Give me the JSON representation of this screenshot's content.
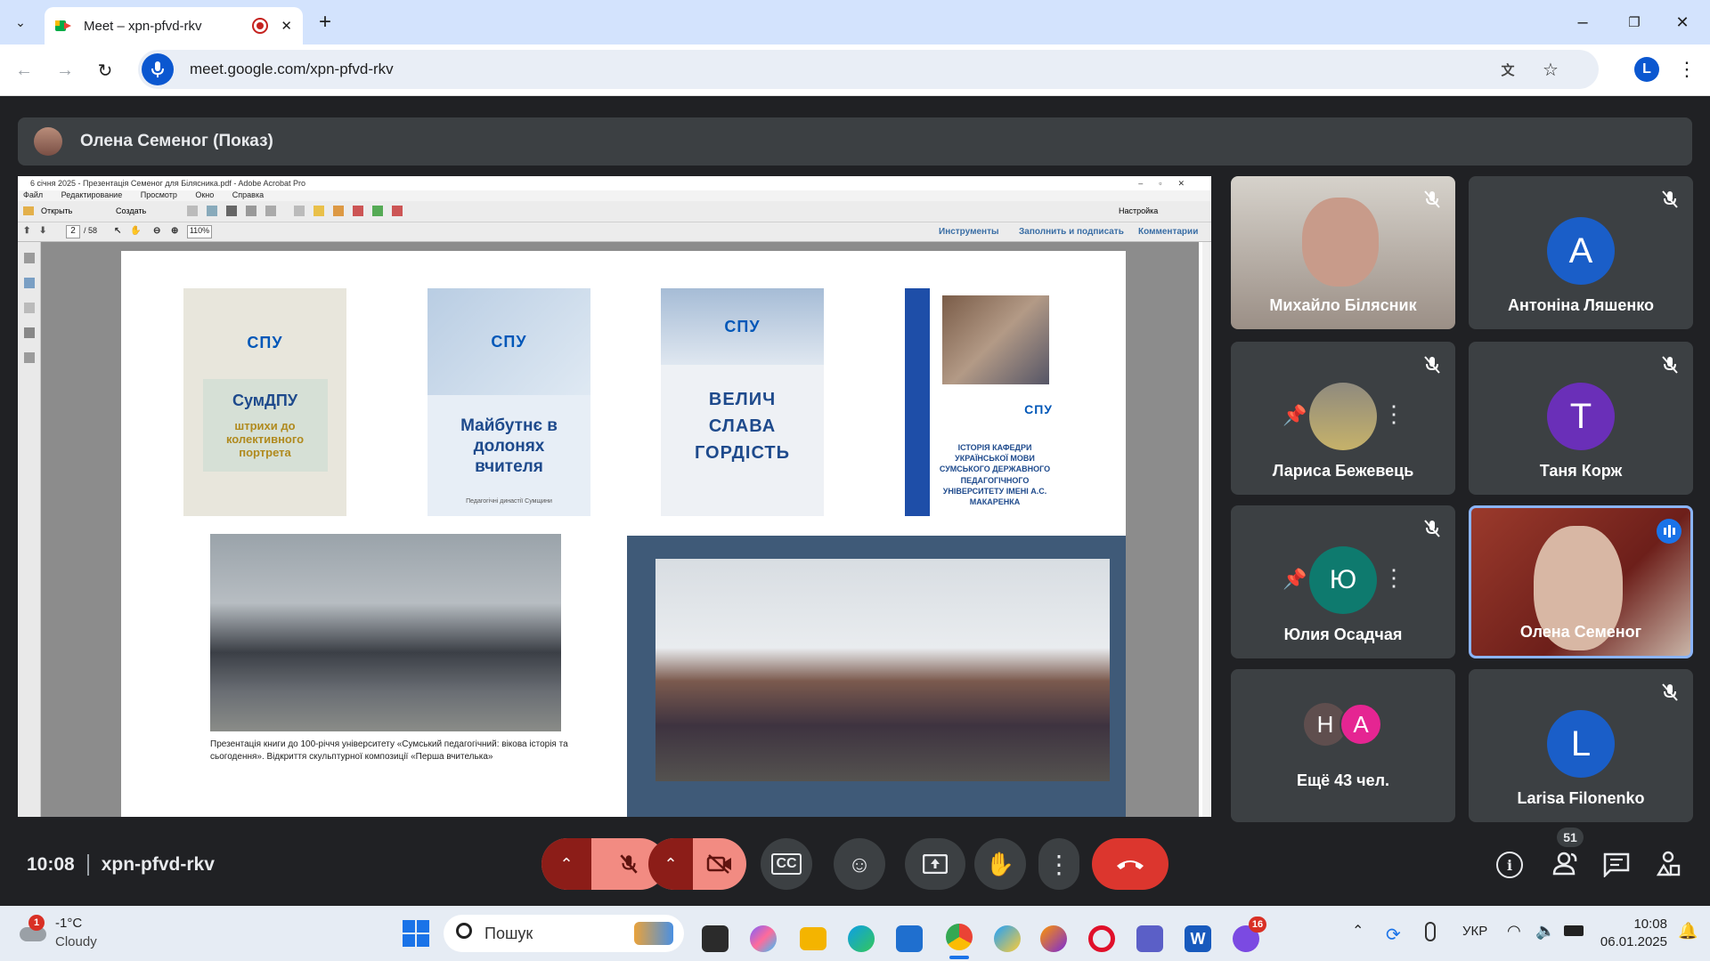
{
  "browser": {
    "tab_title": "Meet – xpn-pfvd-rkv",
    "url": "meet.google.com/xpn-pfvd-rkv",
    "profile_initial": "L"
  },
  "meet": {
    "presenter_label": "Олена Семеног (Показ)",
    "time": "10:08",
    "meeting_code": "xpn-pfvd-rkv",
    "people_count": "51",
    "participants": [
      {
        "name": "Михайло Білясник",
        "initial": ""
      },
      {
        "name": "Антоніна Ляшенко",
        "initial": "A"
      },
      {
        "name": "Лариса Бежевець",
        "initial": ""
      },
      {
        "name": "Таня Корж",
        "initial": "T"
      },
      {
        "name": "Юлия Осадчая",
        "initial": ""
      },
      {
        "name": "Олена Семеног",
        "initial": ""
      },
      {
        "name": "Ещё 43 чел.",
        "initial": ""
      },
      {
        "name": "Larisa Filonenko",
        "initial": "L"
      }
    ],
    "more_initials": [
      "H",
      "A"
    ]
  },
  "acrobat": {
    "title": "6 січня 2025 - Презентація Семеног для Білясника.pdf - Adobe Acrobat Pro",
    "menu": [
      "Файл",
      "Редактирование",
      "Просмотр",
      "Окно",
      "Справка"
    ],
    "open_label": "Открыть",
    "create_label": "Создать",
    "settings_label": "Настройка",
    "page_current": "2",
    "page_total": "/ 58",
    "zoom": "110%",
    "panels": [
      "Инструменты",
      "Заполнить и подписать",
      "Комментарии"
    ]
  },
  "slide": {
    "cover1": {
      "line1": "СумДПУ",
      "line2": "штрихи до колективного портрета"
    },
    "cover2": {
      "text": "Майбутнє в долонях вчителя",
      "foot": "Педагогічні династії Сумщини"
    },
    "cover3": {
      "text": "ВЕЛИЧ СЛАВА ГОРДІСТЬ"
    },
    "cover4": {
      "text": "ІСТОРІЯ КАФЕДРИ УКРАЇНСЬКОЇ МОВИ СУМСЬКОГО ДЕРЖАВНОГО ПЕДАГОГІЧНОГО УНІВЕРСИТЕТУ ІМЕНІ А.С. МАКАРЕНКА"
    },
    "spu_label": "СПУ",
    "caption": "Презентація книги до 100-річчя університету «Сумський педагогічний: вікова історія та сьогодення». Відкриття скульптурної композиції «Перша вчителька»"
  },
  "taskbar": {
    "weather_temp": "-1°C",
    "weather_desc": "Cloudy",
    "weather_badge": "1",
    "search_label": "Пошук",
    "lang": "УКР",
    "clock_time": "10:08",
    "clock_date": "06.01.2025",
    "app_badge": "16"
  }
}
